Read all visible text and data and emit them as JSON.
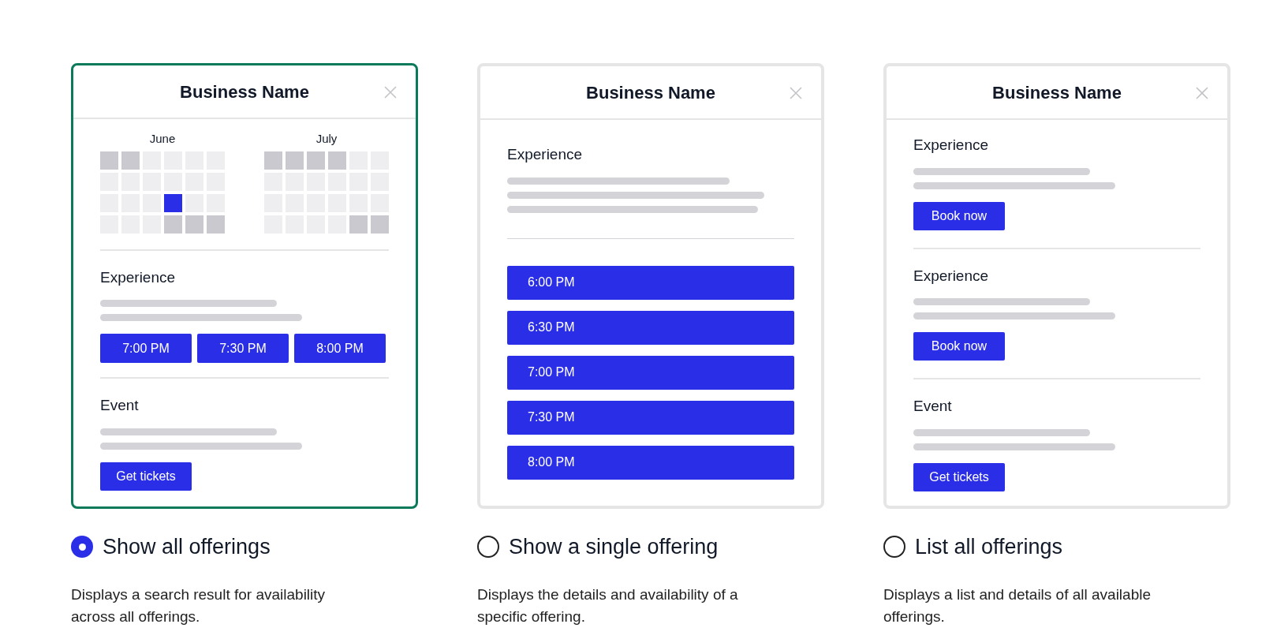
{
  "options": [
    {
      "selected": true,
      "label": "Show all offerings",
      "description": "Displays a search result for availability across all offerings.",
      "card": {
        "kind": "calendar",
        "title": "Business Name",
        "months": [
          {
            "name": "June",
            "cells": [
              {
                "kind": "unavailable"
              },
              {
                "kind": "unavailable"
              },
              {
                "kind": "available"
              },
              {
                "kind": "available"
              },
              {
                "kind": "available"
              },
              {
                "kind": "available"
              },
              {
                "kind": "available"
              },
              {
                "kind": "available"
              },
              {
                "kind": "available"
              },
              {
                "kind": "available"
              },
              {
                "kind": "available"
              },
              {
                "kind": "available"
              },
              {
                "kind": "available"
              },
              {
                "kind": "available"
              },
              {
                "kind": "available"
              },
              {
                "kind": "selected"
              },
              {
                "kind": "available"
              },
              {
                "kind": "available"
              },
              {
                "kind": "available"
              },
              {
                "kind": "available"
              },
              {
                "kind": "available"
              },
              {
                "kind": "unavailable"
              },
              {
                "kind": "unavailable"
              },
              {
                "kind": "unavailable"
              }
            ]
          },
          {
            "name": "July",
            "cells": [
              {
                "kind": "unavailable"
              },
              {
                "kind": "unavailable"
              },
              {
                "kind": "unavailable"
              },
              {
                "kind": "unavailable"
              },
              {
                "kind": "available"
              },
              {
                "kind": "available"
              },
              {
                "kind": "available"
              },
              {
                "kind": "available"
              },
              {
                "kind": "available"
              },
              {
                "kind": "available"
              },
              {
                "kind": "available"
              },
              {
                "kind": "available"
              },
              {
                "kind": "available"
              },
              {
                "kind": "available"
              },
              {
                "kind": "available"
              },
              {
                "kind": "available"
              },
              {
                "kind": "available"
              },
              {
                "kind": "available"
              },
              {
                "kind": "available"
              },
              {
                "kind": "available"
              },
              {
                "kind": "available"
              },
              {
                "kind": "available"
              },
              {
                "kind": "unavailable"
              },
              {
                "kind": "unavailable"
              }
            ]
          }
        ],
        "sections": [
          {
            "kind": "times",
            "title": "Experience",
            "buttons": [
              "7:00 PM",
              "7:30 PM",
              "8:00 PM"
            ]
          },
          {
            "kind": "action",
            "title": "Event",
            "buttons": [
              "Get tickets"
            ]
          }
        ]
      }
    },
    {
      "selected": false,
      "label": "Show a single offering",
      "description": "Displays the details and availability of a specific offering.",
      "card": {
        "kind": "single",
        "title": "Business Name",
        "sections": [
          {
            "kind": "list",
            "title": "Experience",
            "buttons": [
              "6:00 PM",
              "6:30 PM",
              "7:00 PM",
              "7:30 PM",
              "8:00 PM"
            ]
          }
        ]
      }
    },
    {
      "selected": false,
      "label": "List all offerings",
      "description": "Displays a list and details of all available offerings.",
      "card": {
        "kind": "list",
        "title": "Business Name",
        "sections": [
          {
            "kind": "action",
            "title": "Experience",
            "buttons": [
              "Book now"
            ]
          },
          {
            "kind": "action",
            "title": "Experience",
            "buttons": [
              "Book now"
            ]
          },
          {
            "kind": "action",
            "title": "Event",
            "buttons": [
              "Get tickets"
            ]
          }
        ]
      }
    }
  ]
}
